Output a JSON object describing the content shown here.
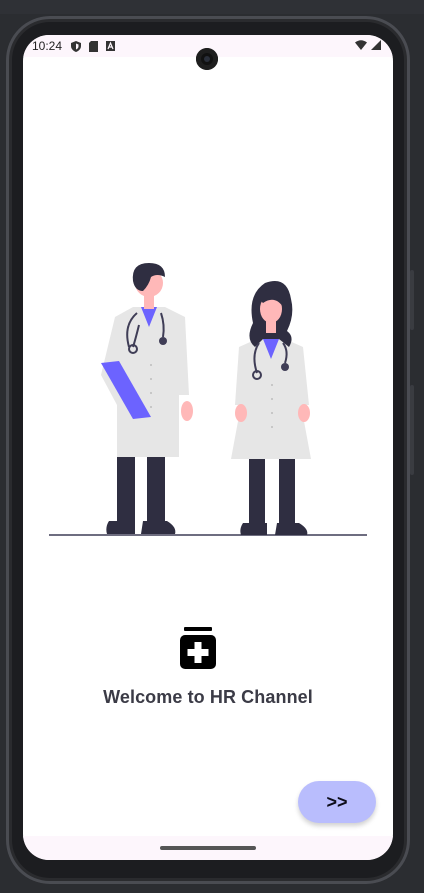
{
  "status_bar": {
    "time": "10:24",
    "left_icons": [
      "shield-icon",
      "sim-card-icon",
      "text-a-icon"
    ],
    "right_icons": [
      "wifi-icon",
      "signal-icon"
    ]
  },
  "illustration": {
    "name": "doctors-illustration"
  },
  "brand_icon": "medicine-bottle-icon",
  "welcome_text": "Welcome to HR Channel",
  "next_button": {
    "label": ">>"
  },
  "colors": {
    "accent": "#6c63ff",
    "button_bg": "#b9bdfd",
    "status_bg": "#fdf6fc",
    "text": "#3b3b46"
  }
}
